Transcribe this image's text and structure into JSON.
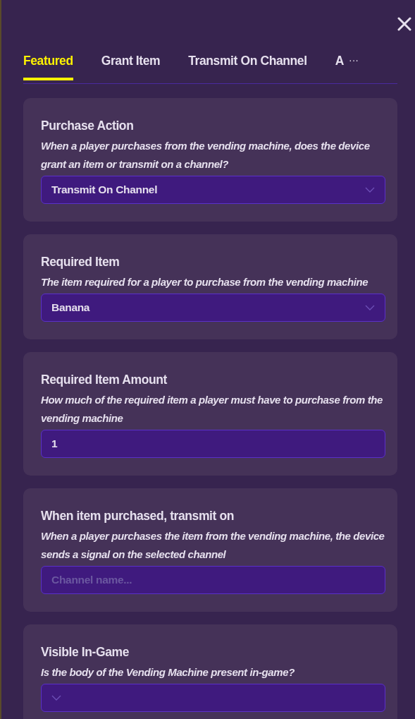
{
  "tabs": [
    {
      "label": "Featured",
      "selected": true
    },
    {
      "label": "Grant Item",
      "selected": false
    },
    {
      "label": "Transmit On Channel",
      "selected": false
    },
    {
      "label": "A",
      "selected": false
    }
  ],
  "more_button": "···",
  "sections": [
    {
      "title": "Purchase Action",
      "description": "When a player purchases from the vending machine, does the device grant an item or transmit on a channel?",
      "field": {
        "kind": "select",
        "value": "Transmit On Channel"
      }
    },
    {
      "title": "Required Item",
      "description": "The item required for a player to purchase from the vending machine",
      "field": {
        "kind": "select",
        "value": "Banana"
      }
    },
    {
      "title": "Required Item Amount",
      "description": "How much of the required item a player must have to purchase from the vending machine",
      "field": {
        "kind": "input",
        "value": "1"
      }
    },
    {
      "title": "When item purchased, transmit on",
      "description": "When a player purchases the item from the vending machine, the device sends a signal on the selected channel",
      "field": {
        "kind": "input",
        "placeholder": "Channel name..."
      }
    },
    {
      "title": "Visible In-Game",
      "description": "Is the body of the Vending Machine present in-game?",
      "field": {
        "kind": "select"
      }
    }
  ]
}
